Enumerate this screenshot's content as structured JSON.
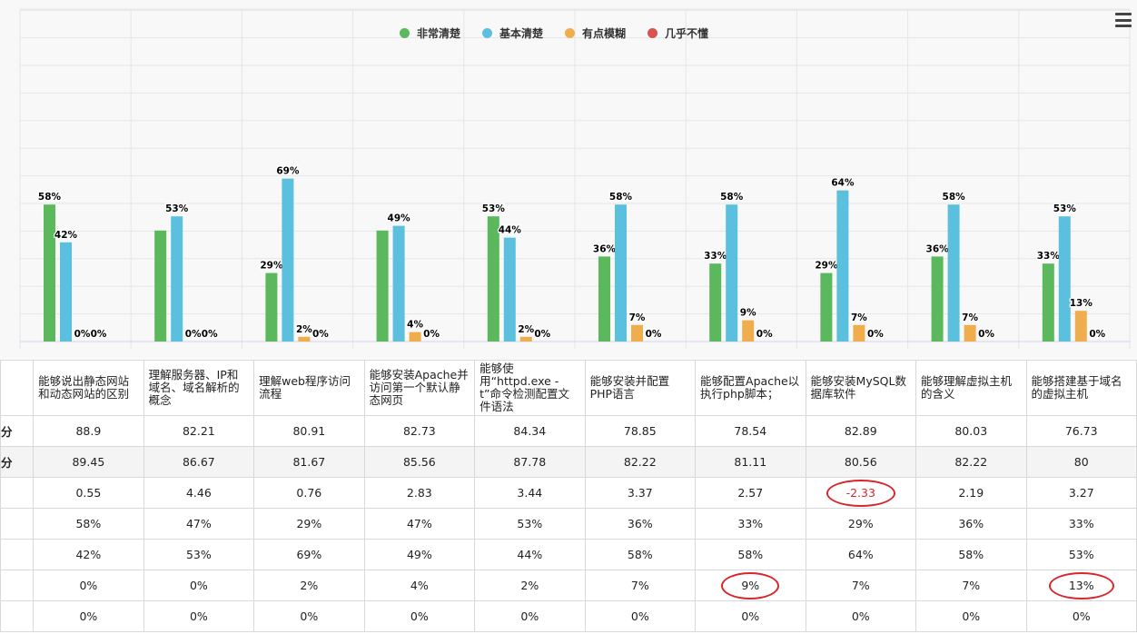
{
  "legend": [
    {
      "name": "非常清楚",
      "color": "#5cb85c"
    },
    {
      "name": "基本清楚",
      "color": "#5bc0de"
    },
    {
      "name": "有点模糊",
      "color": "#f0ad4e"
    },
    {
      "name": "几乎不懂",
      "color": "#d9534f"
    }
  ],
  "menu_icon": "hamburger-menu-icon",
  "chart_data": {
    "type": "bar",
    "categories": [
      "能够说出静态网站和动态网站的区别",
      "理解服务器、IP和域名、域名解析的概念",
      "理解web程序访问流程",
      "能够安装Apache并访问第一个默认静态网页",
      "能够使用“httpd.exe -t”命令检测配置文件语法",
      "能够安装并配置PHP语言",
      "能够配置Apache以执行php脚本；",
      "能够安装MySQL数据库软件",
      "能够理解虚拟主机的含义",
      "能够搭建基于域名的虚拟主机"
    ],
    "series": [
      {
        "name": "非常清楚",
        "color": "#5cb85c",
        "values": [
          58,
          47,
          29,
          47,
          53,
          36,
          33,
          29,
          36,
          33
        ],
        "labels": [
          "58%",
          "",
          "29%",
          "",
          "53%",
          "36%",
          "33%",
          "29%",
          "36%",
          "33%"
        ]
      },
      {
        "name": "基本清楚",
        "color": "#5bc0de",
        "values": [
          42,
          53,
          69,
          49,
          44,
          58,
          58,
          64,
          58,
          53
        ],
        "labels": [
          "42%",
          "53%",
          "69%",
          "49%",
          "44%",
          "58%",
          "58%",
          "64%",
          "58%",
          "53%"
        ]
      },
      {
        "name": "有点模糊",
        "color": "#f0ad4e",
        "values": [
          0,
          0,
          2,
          4,
          2,
          7,
          9,
          7,
          7,
          13
        ],
        "labels": [
          "0%",
          "0%",
          "2%",
          "4%",
          "2%",
          "7%",
          "9%",
          "7%",
          "7%",
          "13%"
        ]
      },
      {
        "name": "几乎不懂",
        "color": "#d9534f",
        "values": [
          0,
          0,
          0,
          0,
          0,
          0,
          0,
          0,
          0,
          0
        ],
        "labels": [
          "0%",
          "0%",
          "0%",
          "0%",
          "0%",
          "0%",
          "0%",
          "0%",
          "0%",
          "0%"
        ]
      }
    ],
    "ylim": [
      0,
      100
    ],
    "grid": true,
    "legend_position": "top-center"
  },
  "table": {
    "headers": [
      "能够说出静态网站和动态网站的区别",
      "理解服务器、IP和域名、域名解析的概念",
      "理解web程序访问流程",
      "能够安装Apache并访问第一个默认静态网页",
      "能够使用“httpd.exe -t”命令检测配置文件语法",
      "能够安装并配置PHP语言",
      "能够配置Apache以执行php脚本；",
      "能够安装MySQL数据库软件",
      "能够理解虚拟主机的含义",
      "能够搭建基于域名的虚拟主机"
    ],
    "rows": [
      {
        "label": "分",
        "cells": [
          "88.9",
          "82.21",
          "80.91",
          "82.73",
          "84.34",
          "78.85",
          "78.54",
          "82.89",
          "80.03",
          "76.73"
        ]
      },
      {
        "label": "分",
        "cells": [
          "89.45",
          "86.67",
          "81.67",
          "85.56",
          "87.78",
          "82.22",
          "81.11",
          "80.56",
          "82.22",
          "80"
        ]
      },
      {
        "label": "",
        "cells": [
          "0.55",
          "4.46",
          "0.76",
          "2.83",
          "3.44",
          "3.37",
          "2.57",
          "-2.33",
          "2.19",
          "3.27"
        ]
      },
      {
        "label": "",
        "cells": [
          "58%",
          "47%",
          "29%",
          "47%",
          "53%",
          "36%",
          "33%",
          "29%",
          "36%",
          "33%"
        ]
      },
      {
        "label": "",
        "cells": [
          "42%",
          "53%",
          "69%",
          "49%",
          "44%",
          "58%",
          "58%",
          "64%",
          "58%",
          "53%"
        ]
      },
      {
        "label": "",
        "cells": [
          "0%",
          "0%",
          "2%",
          "4%",
          "2%",
          "7%",
          "9%",
          "7%",
          "7%",
          "13%"
        ]
      },
      {
        "label": "",
        "cells": [
          "0%",
          "0%",
          "0%",
          "0%",
          "0%",
          "0%",
          "0%",
          "0%",
          "0%",
          "0%"
        ]
      }
    ],
    "highlights": [
      {
        "row": 2,
        "col": 7,
        "color": "#d9262c"
      },
      {
        "row": 5,
        "col": 6,
        "color": "#d9262c"
      },
      {
        "row": 5,
        "col": 9,
        "color": "#d9262c"
      }
    ]
  }
}
